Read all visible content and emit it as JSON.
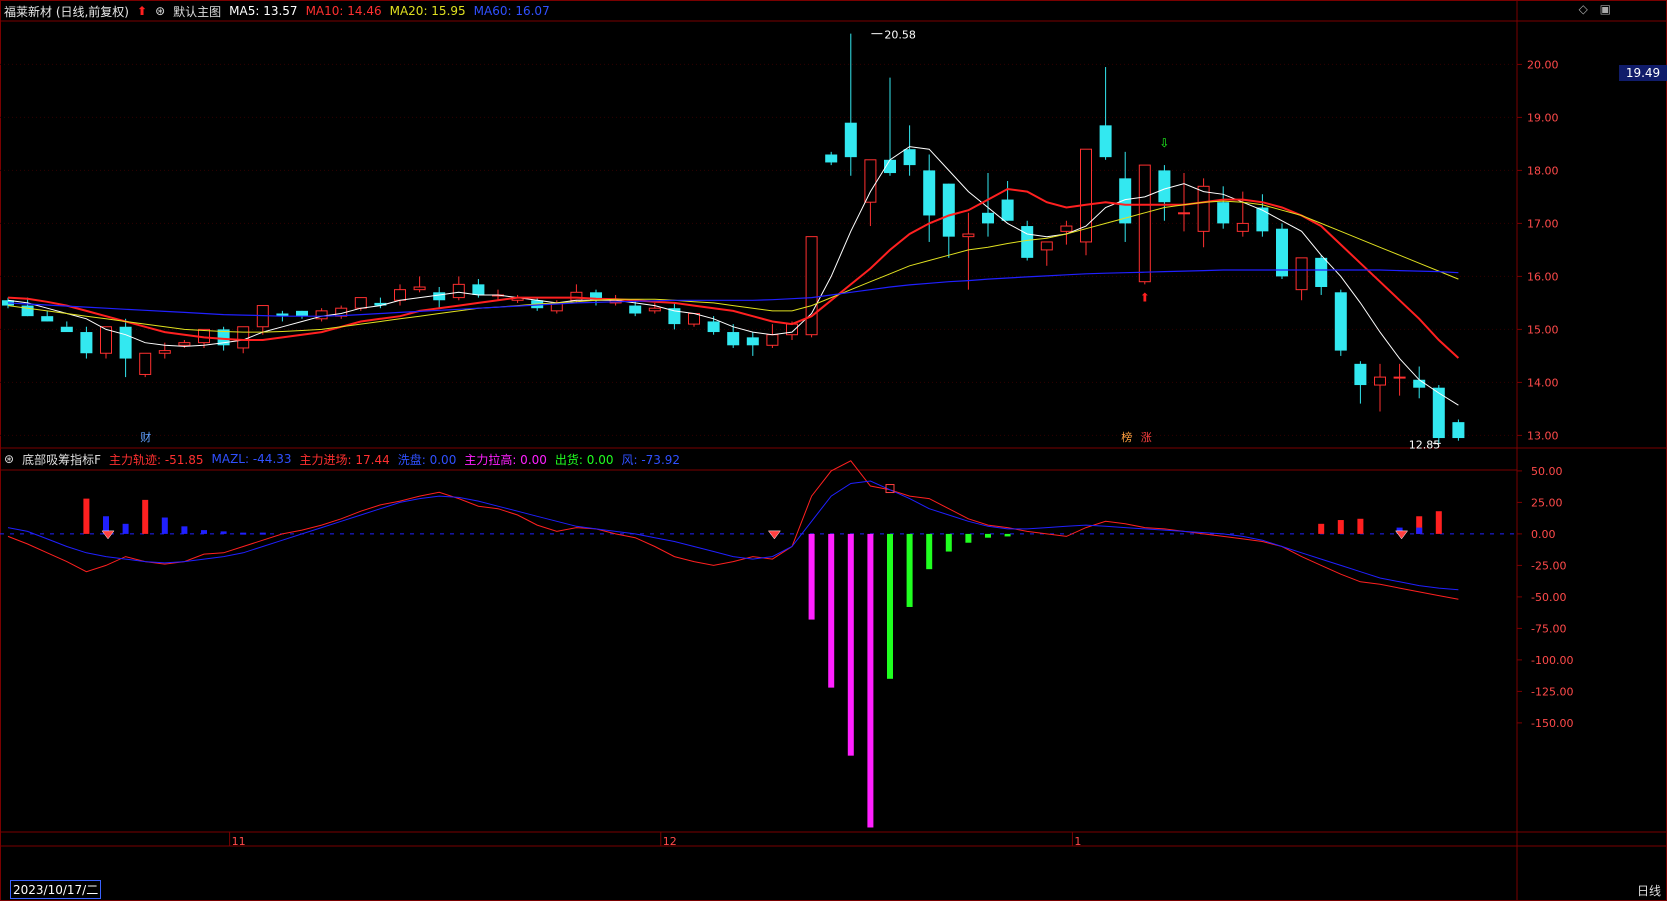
{
  "header": {
    "stock_title": "福莱新材 (日线,前复权)",
    "main_label": "默认主图",
    "ma5_label": "MA5: 13.57",
    "ma10_label": "MA10: 14.46",
    "ma20_label": "MA20: 15.95",
    "ma60_label": "MA60: 16.07"
  },
  "indicator_header": {
    "name": "底部吸筹指标F",
    "main_track": "主力轨迹: -51.85",
    "mazl": "MAZL: -44.33",
    "main_entry": "主力进场: 17.44",
    "wash": "洗盘: 0.00",
    "main_pull": "主力拉高: 0.00",
    "ship": "出货: 0.00",
    "wind": "风: -73.92"
  },
  "annotations": {
    "high": "20.58",
    "low": "12.85",
    "cai": "财",
    "bang": "榜",
    "zhang": "涨"
  },
  "price_tag": "19.49",
  "period_label": "日线",
  "date_start": "2023/10/17/二",
  "colors": {
    "up": "#ff3030",
    "down": "#33e8f0",
    "ma5": "#ffffff",
    "ma10": "#ff2020",
    "ma20": "#e0e020",
    "ma60": "#2020ff",
    "magenta": "#ff20ff",
    "green": "#20ff20",
    "grid": "#7a0000"
  },
  "chart_data": [
    {
      "type": "candlestick",
      "y_ticks": [
        "20.00",
        "19.00",
        "18.00",
        "17.00",
        "16.00",
        "15.00",
        "14.00",
        "13.00"
      ],
      "ylim": [
        12.8,
        20.8
      ],
      "x_ticks": [
        "11",
        "12",
        "1"
      ],
      "ohlc": [
        [
          15.55,
          15.6,
          15.45,
          15.4
        ],
        [
          15.45,
          15.6,
          15.25,
          15.25
        ],
        [
          15.25,
          15.35,
          15.15,
          15.15
        ],
        [
          15.05,
          15.15,
          14.95,
          15.05
        ],
        [
          14.95,
          15.05,
          14.55,
          14.45
        ],
        [
          14.55,
          15.05,
          15.05,
          14.45
        ],
        [
          15.05,
          15.2,
          14.45,
          14.1
        ],
        [
          14.15,
          14.55,
          14.55,
          14.1
        ],
        [
          14.55,
          14.75,
          14.6,
          14.45
        ],
        [
          14.7,
          14.8,
          14.75,
          14.65
        ],
        [
          14.75,
          15.0,
          15.0,
          14.65
        ],
        [
          15.0,
          15.05,
          14.7,
          14.6
        ],
        [
          14.65,
          15.05,
          15.05,
          14.55
        ],
        [
          15.05,
          15.45,
          15.45,
          14.9
        ],
        [
          15.3,
          15.35,
          15.25,
          15.15
        ],
        [
          15.35,
          15.35,
          15.25,
          15.2
        ],
        [
          15.2,
          15.4,
          15.35,
          15.15
        ],
        [
          15.25,
          15.45,
          15.4,
          15.2
        ],
        [
          15.4,
          15.6,
          15.6,
          15.35
        ],
        [
          15.5,
          15.6,
          15.45,
          15.4
        ],
        [
          15.55,
          15.85,
          15.75,
          15.45
        ],
        [
          15.75,
          16.0,
          15.8,
          15.7
        ],
        [
          15.7,
          15.8,
          15.55,
          15.4
        ],
        [
          15.6,
          16.0,
          15.85,
          15.55
        ],
        [
          15.85,
          15.95,
          15.65,
          15.6
        ],
        [
          15.65,
          15.75,
          15.65,
          15.55
        ],
        [
          15.55,
          15.65,
          15.6,
          15.5
        ],
        [
          15.55,
          15.6,
          15.4,
          15.35
        ],
        [
          15.35,
          15.55,
          15.5,
          15.3
        ],
        [
          15.55,
          15.85,
          15.7,
          15.5
        ],
        [
          15.7,
          15.75,
          15.55,
          15.45
        ],
        [
          15.5,
          15.65,
          15.55,
          15.45
        ],
        [
          15.45,
          15.55,
          15.3,
          15.25
        ],
        [
          15.35,
          15.5,
          15.4,
          15.3
        ],
        [
          15.4,
          15.5,
          15.1,
          15.0
        ],
        [
          15.1,
          15.3,
          15.3,
          15.05
        ],
        [
          15.15,
          15.25,
          14.95,
          14.9
        ],
        [
          14.95,
          15.1,
          14.7,
          14.65
        ],
        [
          14.85,
          14.95,
          14.7,
          14.5
        ],
        [
          14.7,
          15.1,
          14.9,
          14.65
        ],
        [
          14.9,
          15.15,
          15.1,
          14.8
        ],
        [
          14.9,
          16.75,
          16.75,
          14.85
        ],
        [
          18.3,
          18.35,
          18.15,
          18.1
        ],
        [
          18.9,
          20.58,
          18.25,
          17.9
        ],
        [
          17.4,
          17.55,
          18.2,
          16.95
        ],
        [
          18.2,
          19.75,
          17.95,
          17.9
        ],
        [
          18.4,
          18.85,
          18.1,
          17.9
        ],
        [
          18.0,
          18.3,
          17.15,
          16.65
        ],
        [
          17.75,
          17.75,
          16.75,
          16.35
        ],
        [
          16.75,
          17.2,
          16.8,
          15.75
        ],
        [
          17.2,
          17.95,
          17.0,
          16.75
        ],
        [
          17.45,
          17.8,
          17.05,
          17.05
        ],
        [
          16.95,
          17.05,
          16.35,
          16.3
        ],
        [
          16.5,
          16.65,
          16.65,
          16.2
        ],
        [
          16.85,
          17.05,
          16.95,
          16.6
        ],
        [
          16.65,
          18.4,
          18.4,
          16.4
        ],
        [
          18.85,
          19.95,
          18.25,
          18.2
        ],
        [
          17.85,
          18.35,
          17.0,
          16.65
        ],
        [
          15.9,
          18.1,
          18.1,
          15.85
        ],
        [
          18.0,
          18.1,
          17.4,
          17.05
        ],
        [
          17.2,
          17.95,
          17.2,
          16.85
        ],
        [
          16.85,
          17.85,
          17.7,
          16.55
        ],
        [
          17.4,
          17.7,
          17.0,
          16.9
        ],
        [
          16.85,
          17.6,
          17.0,
          16.75
        ],
        [
          17.3,
          17.55,
          16.85,
          16.75
        ],
        [
          16.9,
          17.0,
          16.0,
          15.95
        ],
        [
          15.75,
          16.3,
          16.35,
          15.55
        ],
        [
          16.35,
          16.4,
          15.8,
          15.65
        ],
        [
          15.7,
          15.75,
          14.6,
          14.5
        ],
        [
          14.35,
          14.4,
          13.95,
          13.6
        ],
        [
          13.95,
          14.35,
          14.1,
          13.45
        ],
        [
          14.1,
          14.35,
          14.1,
          13.75
        ],
        [
          14.05,
          14.3,
          13.9,
          13.7
        ],
        [
          13.9,
          13.95,
          12.95,
          12.85
        ],
        [
          13.25,
          13.3,
          12.95,
          12.9
        ]
      ],
      "ma_series": [
        {
          "name": "MA5",
          "values": [
            15.55,
            15.5,
            15.4,
            15.3,
            15.2,
            15.0,
            14.9,
            14.75,
            14.7,
            14.68,
            14.7,
            14.75,
            14.8,
            14.95,
            15.05,
            15.15,
            15.25,
            15.3,
            15.4,
            15.45,
            15.55,
            15.6,
            15.65,
            15.7,
            15.65,
            15.65,
            15.6,
            15.55,
            15.5,
            15.55,
            15.55,
            15.55,
            15.5,
            15.45,
            15.35,
            15.3,
            15.2,
            15.05,
            14.95,
            14.9,
            14.95,
            15.3,
            16.0,
            16.85,
            17.6,
            18.2,
            18.45,
            18.4,
            18.0,
            17.6,
            17.3,
            17.0,
            16.8,
            16.75,
            16.8,
            16.95,
            17.3,
            17.45,
            17.5,
            17.65,
            17.75,
            17.6,
            17.55,
            17.4,
            17.25,
            17.05,
            16.85,
            16.4,
            16.0,
            15.5,
            14.95,
            14.45,
            14.05,
            13.8,
            13.57
          ]
        },
        {
          "name": "MA10",
          "values": [
            15.6,
            15.58,
            15.52,
            15.45,
            15.35,
            15.25,
            15.15,
            15.05,
            14.95,
            14.9,
            14.85,
            14.82,
            14.8,
            14.8,
            14.85,
            14.9,
            14.95,
            15.05,
            15.15,
            15.2,
            15.25,
            15.35,
            15.4,
            15.45,
            15.5,
            15.55,
            15.6,
            15.6,
            15.6,
            15.6,
            15.58,
            15.57,
            15.55,
            15.52,
            15.5,
            15.45,
            15.4,
            15.35,
            15.25,
            15.15,
            15.1,
            15.25,
            15.55,
            15.85,
            16.15,
            16.5,
            16.8,
            17.0,
            17.15,
            17.25,
            17.45,
            17.65,
            17.6,
            17.4,
            17.3,
            17.35,
            17.4,
            17.35,
            17.35,
            17.35,
            17.35,
            17.4,
            17.45,
            17.45,
            17.4,
            17.3,
            17.15,
            16.95,
            16.6,
            16.25,
            15.9,
            15.55,
            15.2,
            14.8,
            14.46
          ]
        },
        {
          "name": "MA20",
          "values": [
            15.45,
            15.4,
            15.35,
            15.3,
            15.25,
            15.2,
            15.15,
            15.1,
            15.05,
            15.0,
            14.98,
            14.96,
            14.95,
            14.95,
            14.96,
            14.98,
            15.0,
            15.05,
            15.1,
            15.15,
            15.2,
            15.25,
            15.3,
            15.35,
            15.4,
            15.42,
            15.45,
            15.48,
            15.5,
            15.52,
            15.55,
            15.57,
            15.57,
            15.57,
            15.55,
            15.52,
            15.5,
            15.45,
            15.4,
            15.35,
            15.35,
            15.45,
            15.6,
            15.75,
            15.9,
            16.05,
            16.2,
            16.3,
            16.4,
            16.5,
            16.55,
            16.62,
            16.68,
            16.72,
            16.8,
            16.9,
            17.0,
            17.1,
            17.2,
            17.3,
            17.35,
            17.4,
            17.42,
            17.4,
            17.35,
            17.25,
            17.15,
            17.0,
            16.85,
            16.7,
            16.55,
            16.4,
            16.25,
            16.1,
            15.95
          ]
        },
        {
          "name": "MA60",
          "values": [
            15.5,
            15.48,
            15.46,
            15.44,
            15.42,
            15.4,
            15.38,
            15.36,
            15.34,
            15.32,
            15.3,
            15.28,
            15.27,
            15.26,
            15.25,
            15.25,
            15.25,
            15.26,
            15.28,
            15.3,
            15.32,
            15.34,
            15.36,
            15.38,
            15.4,
            15.42,
            15.44,
            15.46,
            15.48,
            15.5,
            15.51,
            15.52,
            15.53,
            15.54,
            15.55,
            15.55,
            15.55,
            15.55,
            15.55,
            15.56,
            15.58,
            15.6,
            15.65,
            15.7,
            15.75,
            15.8,
            15.84,
            15.87,
            15.9,
            15.92,
            15.95,
            15.97,
            15.99,
            16.01,
            16.03,
            16.05,
            16.06,
            16.07,
            16.08,
            16.09,
            16.1,
            16.11,
            16.12,
            16.12,
            16.12,
            16.12,
            16.12,
            16.12,
            16.12,
            16.12,
            16.12,
            16.11,
            16.1,
            16.09,
            16.07
          ]
        }
      ]
    },
    {
      "type": "indicator",
      "y_ticks": [
        "50.00",
        "25.00",
        "0.00",
        "-25.00",
        "-50.00",
        "-75.00",
        "-100.00",
        "-125.00",
        "-150.00"
      ],
      "ylim": [
        -235,
        65
      ],
      "lines": [
        {
          "name": "主力轨迹",
          "values": [
            -2,
            -8,
            -15,
            -22,
            -30,
            -25,
            -18,
            -22,
            -24,
            -22,
            -16,
            -15,
            -10,
            -5,
            0,
            3,
            7,
            12,
            18,
            23,
            26,
            30,
            33,
            28,
            22,
            20,
            15,
            7,
            2,
            5,
            4,
            0,
            -3,
            -10,
            -18,
            -22,
            -25,
            -22,
            -18,
            -20,
            -10,
            30,
            50,
            58,
            38,
            35,
            30,
            28,
            20,
            12,
            7,
            5,
            2,
            0,
            -2,
            5,
            10,
            8,
            5,
            4,
            2,
            0,
            -2,
            -4,
            -6,
            -10,
            -18,
            -25,
            -32,
            -38,
            -40,
            -43,
            -46,
            -49,
            -51.85
          ]
        },
        {
          "name": "MAZL",
          "values": [
            5,
            2,
            -4,
            -10,
            -15,
            -18,
            -20,
            -22,
            -23,
            -22,
            -20,
            -18,
            -15,
            -10,
            -5,
            0,
            5,
            10,
            15,
            20,
            25,
            28,
            30,
            29,
            26,
            22,
            18,
            14,
            10,
            6,
            4,
            2,
            0,
            -3,
            -6,
            -10,
            -14,
            -18,
            -20,
            -18,
            -10,
            10,
            30,
            40,
            42,
            35,
            28,
            20,
            15,
            10,
            6,
            4,
            4,
            5,
            6,
            7,
            6,
            5,
            4,
            3,
            2,
            1,
            0,
            -2,
            -5,
            -10,
            -15,
            -20,
            -25,
            -30,
            -35,
            -38,
            -41,
            -43,
            -44.33
          ]
        }
      ],
      "bars": [
        {
          "name": "主力进场",
          "color": "#ff2020",
          "points": [
            [
              4,
              28
            ],
            [
              7,
              27
            ],
            [
              67,
              8
            ],
            [
              68,
              11
            ],
            [
              69,
              12
            ],
            [
              72,
              14
            ],
            [
              73,
              18
            ]
          ]
        },
        {
          "name": "blue",
          "color": "#2020ff",
          "points": [
            [
              5,
              14
            ],
            [
              6,
              8
            ],
            [
              8,
              13
            ],
            [
              9,
              6
            ],
            [
              10,
              3
            ],
            [
              11,
              2
            ],
            [
              12,
              1
            ],
            [
              13,
              1
            ],
            [
              71,
              5
            ],
            [
              72,
              5
            ]
          ]
        },
        {
          "name": "主力拉高",
          "color": "#ff20ff",
          "points": [
            [
              41,
              -68
            ],
            [
              42,
              -122
            ],
            [
              43,
              -176
            ],
            [
              44,
              -233
            ]
          ]
        },
        {
          "name": "出货",
          "color": "#20ff20",
          "points": [
            [
              45,
              -115
            ],
            [
              46,
              -58
            ],
            [
              47,
              -28
            ],
            [
              48,
              -14
            ],
            [
              49,
              -7
            ],
            [
              50,
              -3
            ],
            [
              51,
              -2
            ]
          ]
        }
      ]
    }
  ]
}
